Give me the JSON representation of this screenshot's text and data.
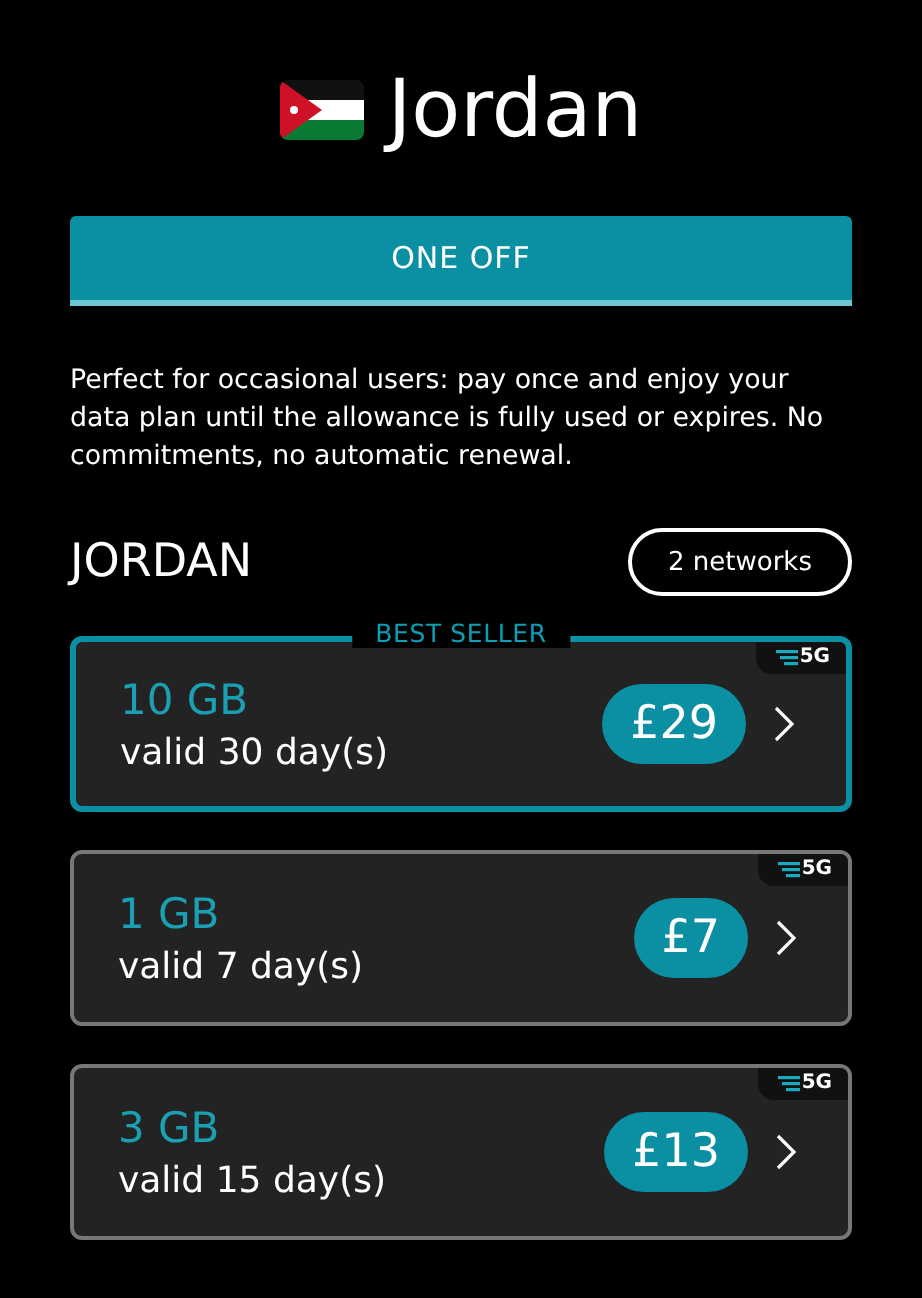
{
  "header": {
    "title": "Jordan"
  },
  "tabs": [
    {
      "label": "ONE OFF",
      "selected": true
    }
  ],
  "description": "Perfect for occasional users: pay once and enjoy your data plan until the allowance is fully used or expires. No commitments, no automatic renewal.",
  "section": {
    "title": "JORDAN",
    "networks_button": "2 networks"
  },
  "plans": [
    {
      "data": "10 GB",
      "validity": "valid 30 day(s)",
      "price": "£29",
      "network": "5G",
      "highlight": "BEST SELLER",
      "selected": true
    },
    {
      "data": "1 GB",
      "validity": "valid 7 day(s)",
      "price": "£7",
      "network": "5G",
      "selected": false
    },
    {
      "data": "3 GB",
      "validity": "valid 15 day(s)",
      "price": "£13",
      "network": "5G",
      "selected": false
    }
  ]
}
